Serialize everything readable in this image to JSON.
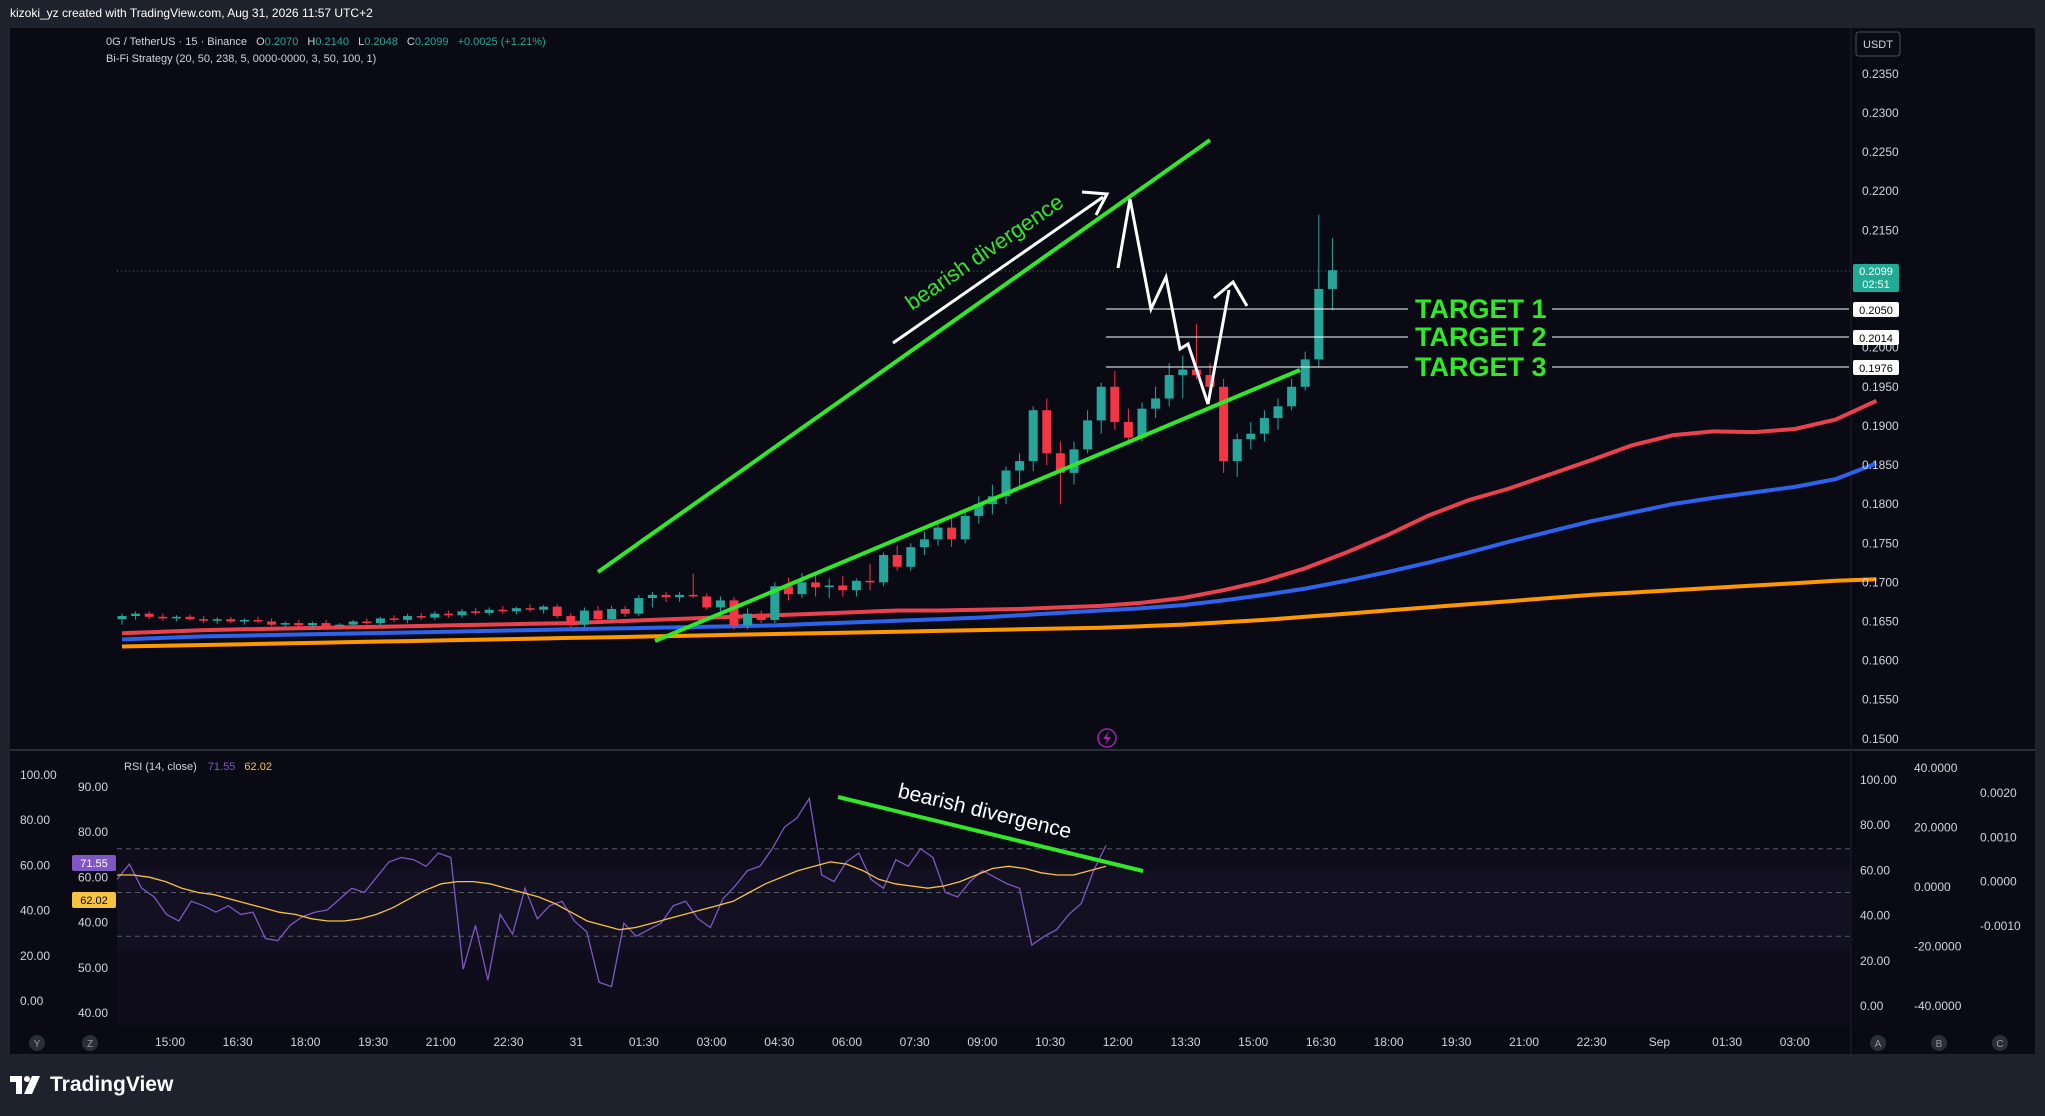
{
  "header": {
    "attribution": "kizoki_yz created with TradingView.com, Aug 31, 2026 11:57 UTC+2"
  },
  "footer": {
    "brand": "TradingView"
  },
  "legend": {
    "symbol": "0G / TetherUS · 15 · Binance",
    "o_label": "O",
    "o": "0.2070",
    "h_label": "H",
    "h": "0.2140",
    "l_label": "L",
    "l": "0.2048",
    "c_label": "C",
    "c": "0.2099",
    "change": "+0.0025 (+1.21%)",
    "strategy": "Bi-Fi Strategy (20, 50, 238, 5, 0000-0000, 3, 50, 100, 1)",
    "rsi_label": "RSI (14, close)",
    "rsi_value": "71.55",
    "rsi_ma": "62.02"
  },
  "currency_button": "USDT",
  "price_badge": {
    "value": "0.2099",
    "countdown": "02:51"
  },
  "targets": [
    {
      "label": "TARGET 1",
      "price": "0.2050"
    },
    {
      "label": "TARGET 2",
      "price": "0.2014"
    },
    {
      "label": "TARGET 3",
      "price": "0.1976"
    }
  ],
  "annotations": {
    "divergence_price": "bearish divergence",
    "divergence_rsi": "bearish divergence"
  },
  "rsi_left_axis": [
    "100.00",
    "90.00",
    "80.00",
    "80.00",
    "60.00",
    "60.00",
    "40.00",
    "40.00",
    "20.00",
    "50.00",
    "0.00",
    "40.00"
  ],
  "rsi_badges": {
    "rsi": "71.55",
    "ma": "62.02"
  },
  "rsi_right_axis_1": [
    "100.00",
    "80.00",
    "60.00",
    "40.00",
    "20.00",
    "0.00"
  ],
  "rsi_right_axis_2": [
    "40.0000",
    "20.0000",
    "0.0000",
    "-20.0000",
    "-40.0000"
  ],
  "rsi_right_axis_3": [
    "0.0020",
    "0.0010",
    "0.0000",
    "-0.0010"
  ],
  "time_axis_buttons_left": [
    "Y",
    "Z"
  ],
  "time_axis_buttons_right": [
    "A",
    "B",
    "C"
  ],
  "colors": {
    "up": "#26a69a",
    "down": "#f23645",
    "ema_fast": "#e8424f",
    "ema_mid": "#2d62ea",
    "ema_slow": "#ff9800",
    "trend": "#32e62a",
    "rsi": "#7e57c2",
    "rsi_ma": "#f5c342",
    "badge": "#22ab94"
  },
  "chart_data": {
    "type": "candlestick",
    "title": "0G / TetherUS · 15 · Binance",
    "price_axis": {
      "range": [
        0.1496,
        0.2374
      ],
      "ticks": [
        "0.2350",
        "0.2300",
        "0.2250",
        "0.2200",
        "0.2150",
        "0.2100",
        "0.2050",
        "0.2000",
        "0.1950",
        "0.1900",
        "0.1850",
        "0.1800",
        "0.1750",
        "0.1700",
        "0.1650",
        "0.1600",
        "0.1550",
        "0.1500"
      ]
    },
    "time_axis": {
      "ticks": [
        "15:00",
        "16:30",
        "18:00",
        "19:30",
        "21:00",
        "22:30",
        "31",
        "01:30",
        "03:00",
        "04:30",
        "06:00",
        "07:30",
        "09:00",
        "10:30",
        "12:00",
        "13:30",
        "15:00",
        "16:30",
        "18:00",
        "19:30",
        "21:00",
        "22:30",
        "Sep",
        "01:30",
        "03:00"
      ]
    },
    "candles": [
      {
        "o": 0.1653,
        "h": 0.166,
        "l": 0.1646,
        "c": 0.1657
      },
      {
        "o": 0.1657,
        "h": 0.1663,
        "l": 0.1652,
        "c": 0.166
      },
      {
        "o": 0.166,
        "h": 0.1663,
        "l": 0.1653,
        "c": 0.1656
      },
      {
        "o": 0.1656,
        "h": 0.166,
        "l": 0.1651,
        "c": 0.1654
      },
      {
        "o": 0.1654,
        "h": 0.1658,
        "l": 0.165,
        "c": 0.1656
      },
      {
        "o": 0.1656,
        "h": 0.1659,
        "l": 0.1651,
        "c": 0.1653
      },
      {
        "o": 0.1653,
        "h": 0.1657,
        "l": 0.1648,
        "c": 0.1651
      },
      {
        "o": 0.1651,
        "h": 0.1655,
        "l": 0.1647,
        "c": 0.1653
      },
      {
        "o": 0.1653,
        "h": 0.1656,
        "l": 0.1648,
        "c": 0.165
      },
      {
        "o": 0.165,
        "h": 0.1654,
        "l": 0.1646,
        "c": 0.1652
      },
      {
        "o": 0.1652,
        "h": 0.1656,
        "l": 0.1648,
        "c": 0.165
      },
      {
        "o": 0.165,
        "h": 0.1654,
        "l": 0.1644,
        "c": 0.1646
      },
      {
        "o": 0.1646,
        "h": 0.165,
        "l": 0.1642,
        "c": 0.1648
      },
      {
        "o": 0.1648,
        "h": 0.1652,
        "l": 0.1643,
        "c": 0.1645
      },
      {
        "o": 0.1645,
        "h": 0.165,
        "l": 0.1641,
        "c": 0.1648
      },
      {
        "o": 0.1648,
        "h": 0.1652,
        "l": 0.1642,
        "c": 0.1644
      },
      {
        "o": 0.1644,
        "h": 0.1648,
        "l": 0.164,
        "c": 0.1646
      },
      {
        "o": 0.1646,
        "h": 0.1652,
        "l": 0.1642,
        "c": 0.165
      },
      {
        "o": 0.165,
        "h": 0.1654,
        "l": 0.1646,
        "c": 0.1648
      },
      {
        "o": 0.1648,
        "h": 0.1656,
        "l": 0.1645,
        "c": 0.1654
      },
      {
        "o": 0.1654,
        "h": 0.1658,
        "l": 0.1649,
        "c": 0.1652
      },
      {
        "o": 0.1652,
        "h": 0.166,
        "l": 0.1648,
        "c": 0.1657
      },
      {
        "o": 0.1657,
        "h": 0.1661,
        "l": 0.1652,
        "c": 0.1655
      },
      {
        "o": 0.1655,
        "h": 0.1663,
        "l": 0.1652,
        "c": 0.166
      },
      {
        "o": 0.166,
        "h": 0.1664,
        "l": 0.1655,
        "c": 0.1658
      },
      {
        "o": 0.1658,
        "h": 0.1666,
        "l": 0.1655,
        "c": 0.1663
      },
      {
        "o": 0.1663,
        "h": 0.1667,
        "l": 0.1658,
        "c": 0.1661
      },
      {
        "o": 0.1661,
        "h": 0.1668,
        "l": 0.1658,
        "c": 0.1665
      },
      {
        "o": 0.1665,
        "h": 0.167,
        "l": 0.166,
        "c": 0.1663
      },
      {
        "o": 0.1663,
        "h": 0.1669,
        "l": 0.1659,
        "c": 0.1667
      },
      {
        "o": 0.1667,
        "h": 0.1672,
        "l": 0.1662,
        "c": 0.1665
      },
      {
        "o": 0.1665,
        "h": 0.1671,
        "l": 0.166,
        "c": 0.1669
      },
      {
        "o": 0.1669,
        "h": 0.1672,
        "l": 0.1654,
        "c": 0.1657
      },
      {
        "o": 0.1657,
        "h": 0.1661,
        "l": 0.1643,
        "c": 0.1646
      },
      {
        "o": 0.1646,
        "h": 0.1668,
        "l": 0.1643,
        "c": 0.1664
      },
      {
        "o": 0.1664,
        "h": 0.167,
        "l": 0.165,
        "c": 0.1653
      },
      {
        "o": 0.1653,
        "h": 0.167,
        "l": 0.165,
        "c": 0.1666
      },
      {
        "o": 0.1666,
        "h": 0.167,
        "l": 0.1656,
        "c": 0.166
      },
      {
        "o": 0.166,
        "h": 0.1684,
        "l": 0.1657,
        "c": 0.168
      },
      {
        "o": 0.168,
        "h": 0.1688,
        "l": 0.1668,
        "c": 0.1684
      },
      {
        "o": 0.1684,
        "h": 0.1688,
        "l": 0.1675,
        "c": 0.1681
      },
      {
        "o": 0.1681,
        "h": 0.1688,
        "l": 0.1675,
        "c": 0.1684
      },
      {
        "o": 0.1684,
        "h": 0.1711,
        "l": 0.168,
        "c": 0.1682
      },
      {
        "o": 0.1682,
        "h": 0.1686,
        "l": 0.1665,
        "c": 0.1668
      },
      {
        "o": 0.1668,
        "h": 0.1682,
        "l": 0.1655,
        "c": 0.1677
      },
      {
        "o": 0.1677,
        "h": 0.1681,
        "l": 0.164,
        "c": 0.1645
      },
      {
        "o": 0.1645,
        "h": 0.1667,
        "l": 0.164,
        "c": 0.166
      },
      {
        "o": 0.166,
        "h": 0.1664,
        "l": 0.1648,
        "c": 0.1652
      },
      {
        "o": 0.1652,
        "h": 0.17,
        "l": 0.1648,
        "c": 0.1695
      },
      {
        "o": 0.1695,
        "h": 0.1706,
        "l": 0.1677,
        "c": 0.1685
      },
      {
        "o": 0.1685,
        "h": 0.1712,
        "l": 0.168,
        "c": 0.17
      },
      {
        "o": 0.17,
        "h": 0.1714,
        "l": 0.1682,
        "c": 0.1694
      },
      {
        "o": 0.1694,
        "h": 0.1705,
        "l": 0.168,
        "c": 0.1696
      },
      {
        "o": 0.1696,
        "h": 0.1708,
        "l": 0.1682,
        "c": 0.169
      },
      {
        "o": 0.169,
        "h": 0.1705,
        "l": 0.1682,
        "c": 0.1702
      },
      {
        "o": 0.1702,
        "h": 0.1724,
        "l": 0.169,
        "c": 0.17
      },
      {
        "o": 0.17,
        "h": 0.1738,
        "l": 0.1695,
        "c": 0.1735
      },
      {
        "o": 0.1735,
        "h": 0.1747,
        "l": 0.1715,
        "c": 0.172
      },
      {
        "o": 0.172,
        "h": 0.175,
        "l": 0.1715,
        "c": 0.1745
      },
      {
        "o": 0.1745,
        "h": 0.1765,
        "l": 0.1735,
        "c": 0.1755
      },
      {
        "o": 0.1755,
        "h": 0.1775,
        "l": 0.1747,
        "c": 0.177
      },
      {
        "o": 0.177,
        "h": 0.1783,
        "l": 0.1745,
        "c": 0.1755
      },
      {
        "o": 0.1755,
        "h": 0.179,
        "l": 0.175,
        "c": 0.1785
      },
      {
        "o": 0.1785,
        "h": 0.181,
        "l": 0.1775,
        "c": 0.18
      },
      {
        "o": 0.18,
        "h": 0.1825,
        "l": 0.1787,
        "c": 0.181
      },
      {
        "o": 0.181,
        "h": 0.1848,
        "l": 0.18,
        "c": 0.1843
      },
      {
        "o": 0.1843,
        "h": 0.1865,
        "l": 0.182,
        "c": 0.1855
      },
      {
        "o": 0.1855,
        "h": 0.1925,
        "l": 0.1842,
        "c": 0.192
      },
      {
        "o": 0.192,
        "h": 0.1935,
        "l": 0.185,
        "c": 0.1865
      },
      {
        "o": 0.1865,
        "h": 0.188,
        "l": 0.18,
        "c": 0.184
      },
      {
        "o": 0.184,
        "h": 0.188,
        "l": 0.1825,
        "c": 0.187
      },
      {
        "o": 0.187,
        "h": 0.192,
        "l": 0.1865,
        "c": 0.1907
      },
      {
        "o": 0.1907,
        "h": 0.1955,
        "l": 0.189,
        "c": 0.195
      },
      {
        "o": 0.195,
        "h": 0.197,
        "l": 0.1895,
        "c": 0.1905
      },
      {
        "o": 0.1905,
        "h": 0.1922,
        "l": 0.188,
        "c": 0.1885
      },
      {
        "o": 0.1885,
        "h": 0.193,
        "l": 0.188,
        "c": 0.1922
      },
      {
        "o": 0.1922,
        "h": 0.195,
        "l": 0.191,
        "c": 0.1935
      },
      {
        "o": 0.1935,
        "h": 0.198,
        "l": 0.1925,
        "c": 0.1965
      },
      {
        "o": 0.1965,
        "h": 0.199,
        "l": 0.1935,
        "c": 0.1972
      },
      {
        "o": 0.1972,
        "h": 0.203,
        "l": 0.196,
        "c": 0.1965
      },
      {
        "o": 0.1965,
        "h": 0.198,
        "l": 0.1935,
        "c": 0.195
      },
      {
        "o": 0.195,
        "h": 0.196,
        "l": 0.184,
        "c": 0.1855
      },
      {
        "o": 0.1855,
        "h": 0.189,
        "l": 0.1835,
        "c": 0.1883
      },
      {
        "o": 0.1883,
        "h": 0.1905,
        "l": 0.187,
        "c": 0.189
      },
      {
        "o": 0.189,
        "h": 0.192,
        "l": 0.188,
        "c": 0.191
      },
      {
        "o": 0.191,
        "h": 0.1935,
        "l": 0.1895,
        "c": 0.1925
      },
      {
        "o": 0.1925,
        "h": 0.196,
        "l": 0.192,
        "c": 0.195
      },
      {
        "o": 0.195,
        "h": 0.1995,
        "l": 0.1945,
        "c": 0.1985
      },
      {
        "o": 0.1985,
        "h": 0.217,
        "l": 0.1975,
        "c": 0.2075
      },
      {
        "o": 0.2075,
        "h": 0.214,
        "l": 0.2048,
        "c": 0.2099
      }
    ],
    "ema_fast": [
      0.1635,
      0.1637,
      0.1639,
      0.164,
      0.1641,
      0.1642,
      0.1643,
      0.1644,
      0.1645,
      0.1646,
      0.1647,
      0.1648,
      0.165,
      0.1652,
      0.1654,
      0.1656,
      0.1658,
      0.166,
      0.1662,
      0.1664,
      0.1664,
      0.1665,
      0.1666,
      0.1668,
      0.167,
      0.1674,
      0.168,
      0.169,
      0.1702,
      0.1718,
      0.1738,
      0.176,
      0.1785,
      0.1805,
      0.182,
      0.1838,
      0.1856,
      0.1875,
      0.1888,
      0.1893,
      0.1892,
      0.1896,
      0.1908,
      0.1932
    ],
    "ema_mid": [
      0.1627,
      0.1629,
      0.1631,
      0.1632,
      0.1633,
      0.1634,
      0.1635,
      0.1636,
      0.1637,
      0.1638,
      0.1639,
      0.164,
      0.1641,
      0.1642,
      0.1643,
      0.1644,
      0.1645,
      0.1647,
      0.1649,
      0.1651,
      0.1653,
      0.1655,
      0.1658,
      0.1661,
      0.1664,
      0.1667,
      0.1671,
      0.1677,
      0.1684,
      0.1692,
      0.1702,
      0.1713,
      0.1725,
      0.1738,
      0.1752,
      0.1765,
      0.1778,
      0.1789,
      0.18,
      0.1808,
      0.1815,
      0.1822,
      0.1832,
      0.1852
    ],
    "ema_slow": [
      0.1618,
      0.1619,
      0.162,
      0.1621,
      0.1622,
      0.1623,
      0.1624,
      0.1625,
      0.1626,
      0.1627,
      0.1628,
      0.1629,
      0.163,
      0.1631,
      0.1632,
      0.1633,
      0.1634,
      0.1635,
      0.1636,
      0.1637,
      0.1638,
      0.1639,
      0.164,
      0.1641,
      0.1642,
      0.1644,
      0.1646,
      0.1649,
      0.1652,
      0.1656,
      0.166,
      0.1664,
      0.1668,
      0.1672,
      0.1676,
      0.168,
      0.1684,
      0.1687,
      0.169,
      0.1693,
      0.1696,
      0.1699,
      0.1702,
      0.1704
    ],
    "rsi": {
      "range": [
        -11,
        106
      ],
      "values": [
        56,
        63,
        52,
        48,
        40,
        37,
        46,
        44,
        41,
        44,
        40,
        41,
        29,
        28,
        35,
        39,
        41,
        42,
        47,
        52,
        50,
        57,
        64,
        66,
        65,
        62,
        68,
        66,
        15,
        35,
        10,
        40,
        31,
        52,
        38,
        44,
        46,
        37,
        32,
        9,
        7,
        36,
        30,
        33,
        36,
        44,
        46,
        38,
        34,
        47,
        53,
        60,
        62,
        70,
        80,
        84,
        93,
        58,
        55,
        64,
        68,
        56,
        52,
        65,
        62,
        70,
        66,
        50,
        48,
        55,
        60,
        57,
        54,
        52,
        26,
        30,
        33,
        40,
        45,
        60,
        71.55
      ],
      "ma": [
        58,
        58,
        57,
        55,
        52,
        50,
        49,
        47,
        45,
        43,
        41,
        40,
        38,
        37,
        37,
        38,
        40,
        43,
        47,
        51,
        54,
        55,
        55,
        54,
        52,
        50,
        48,
        45,
        41,
        37,
        35,
        33,
        34,
        36,
        38,
        40,
        42,
        44,
        46,
        50,
        54,
        57,
        60,
        62,
        64,
        63,
        60,
        56,
        54,
        53,
        52,
        53,
        55,
        58,
        61,
        62,
        61,
        59,
        58,
        58,
        60,
        62.02
      ],
      "levels": [
        70,
        50,
        30
      ]
    }
  }
}
